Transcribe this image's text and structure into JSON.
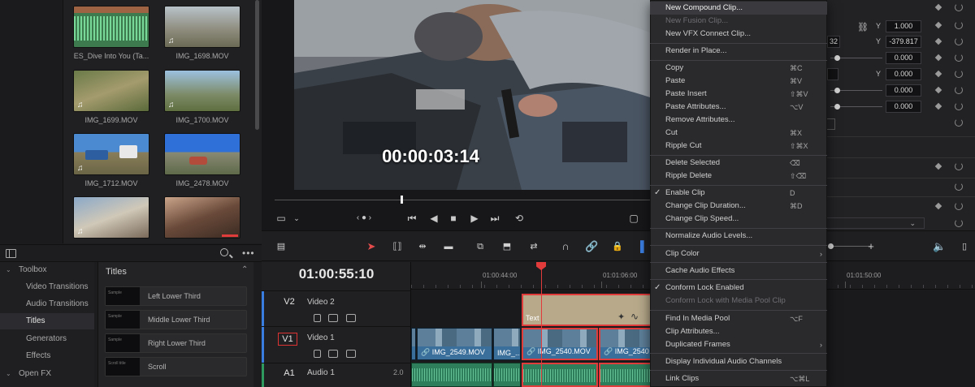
{
  "media_pool": {
    "clips": [
      {
        "name": "ES_Dive Into You (Ta...",
        "kind": "audio"
      },
      {
        "name": "IMG_1698.MOV",
        "kind": "video"
      },
      {
        "name": "IMG_1699.MOV",
        "kind": "video"
      },
      {
        "name": "IMG_1700.MOV",
        "kind": "video"
      },
      {
        "name": "IMG_1712.MOV",
        "kind": "video"
      },
      {
        "name": "IMG_2478.MOV",
        "kind": "video"
      },
      {
        "name": "",
        "kind": "video"
      },
      {
        "name": "",
        "kind": "video"
      }
    ]
  },
  "effects": {
    "tree": [
      {
        "label": "Toolbox",
        "expanded": true
      },
      {
        "label": "Video Transitions"
      },
      {
        "label": "Audio Transitions"
      },
      {
        "label": "Titles",
        "selected": true
      },
      {
        "label": "Generators"
      },
      {
        "label": "Effects"
      },
      {
        "label": "Open FX",
        "expanded": true
      }
    ],
    "titles_header": "Titles",
    "titles": [
      {
        "name": "Left Lower Third",
        "swatch": "Sample"
      },
      {
        "name": "Middle Lower Third",
        "swatch": "Sample"
      },
      {
        "name": "Right Lower Third",
        "swatch": "Sample"
      },
      {
        "name": "Scroll",
        "swatch": "Scroll title"
      }
    ]
  },
  "viewer": {
    "timecode": "00:00:03:14"
  },
  "inspector": {
    "zoom_y_label": "Y",
    "zoom_y": "1.000",
    "position_x_partial": "32",
    "position_y_label": "Y",
    "position_y": "-379.817",
    "rotation": "0.000",
    "anchor_y_label": "Y",
    "anchor_y": "0.000",
    "pitch": "0.000",
    "yaw": "0.000"
  },
  "timeline": {
    "timecode": "01:00:55:10",
    "ruler_labels": [
      "01:00:44:00",
      "01:01:06:00",
      "01:01:50:00"
    ],
    "tracks": [
      {
        "id": "V2",
        "name": "Video 2"
      },
      {
        "id": "V1",
        "name": "Video 1"
      },
      {
        "id": "A1",
        "name": "Audio 1",
        "level": "2.0"
      }
    ],
    "title_clip": "Text",
    "video_clips": [
      "",
      "IMG_2549.MOV",
      "IMG_...",
      "IMG_2540.MOV",
      "IMG_2540"
    ]
  },
  "context_menu": {
    "groups": [
      [
        {
          "label": "New Compound Clip...",
          "highlight": true
        },
        {
          "label": "New Fusion Clip...",
          "disabled": true
        },
        {
          "label": "New VFX Connect Clip..."
        }
      ],
      [
        {
          "label": "Render in Place..."
        }
      ],
      [
        {
          "label": "Copy",
          "shortcut": "⌘C"
        },
        {
          "label": "Paste",
          "shortcut": "⌘V"
        },
        {
          "label": "Paste Insert",
          "shortcut": "⇧⌘V"
        },
        {
          "label": "Paste Attributes...",
          "shortcut": "⌥V"
        },
        {
          "label": "Remove Attributes..."
        },
        {
          "label": "Cut",
          "shortcut": "⌘X"
        },
        {
          "label": "Ripple Cut",
          "shortcut": "⇧⌘X"
        }
      ],
      [
        {
          "label": "Delete Selected",
          "shortcut": "⌫"
        },
        {
          "label": "Ripple Delete",
          "shortcut": "⇧⌫"
        }
      ],
      [
        {
          "label": "Enable Clip",
          "shortcut": "D",
          "checked": true
        },
        {
          "label": "Change Clip Duration...",
          "shortcut": "⌘D"
        },
        {
          "label": "Change Clip Speed..."
        }
      ],
      [
        {
          "label": "Normalize Audio Levels..."
        }
      ],
      [
        {
          "label": "Clip Color",
          "submenu": true
        }
      ],
      [
        {
          "label": "Cache Audio Effects"
        }
      ],
      [
        {
          "label": "Conform Lock Enabled",
          "checked": true
        },
        {
          "label": "Conform Lock with Media Pool Clip",
          "disabled": true
        }
      ],
      [
        {
          "label": "Find In Media Pool",
          "shortcut": "⌥F"
        },
        {
          "label": "Clip Attributes..."
        },
        {
          "label": "Duplicated Frames",
          "submenu": true
        }
      ],
      [
        {
          "label": "Display Individual Audio Channels"
        }
      ],
      [
        {
          "label": "Link Clips",
          "shortcut": "⌥⌘L"
        }
      ]
    ]
  }
}
